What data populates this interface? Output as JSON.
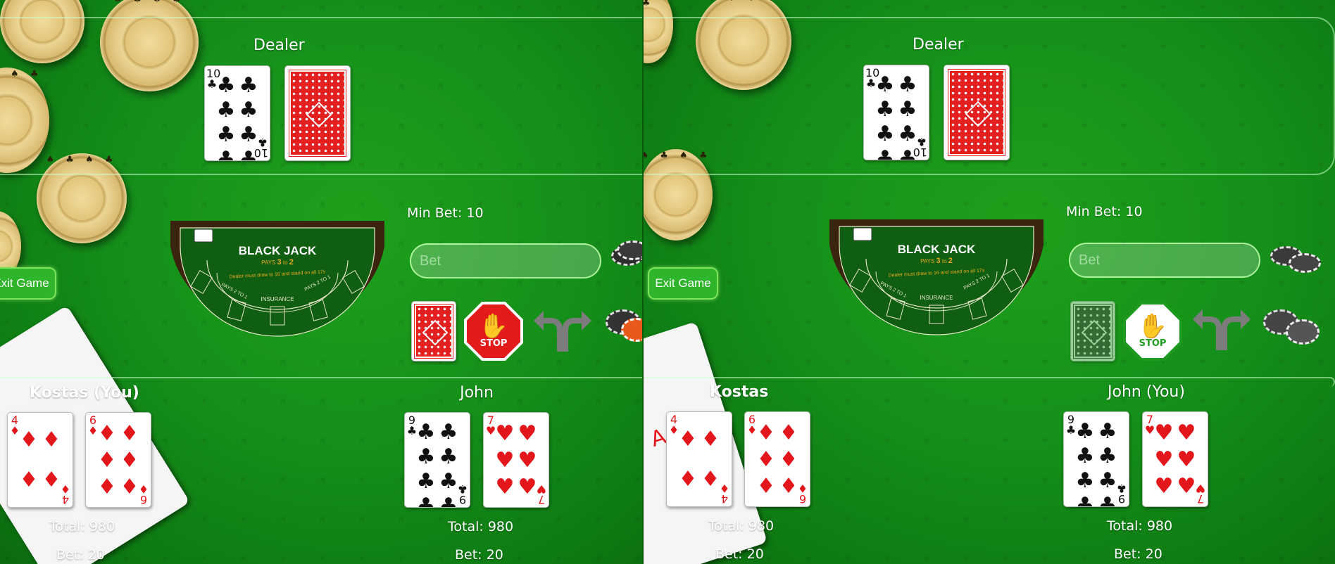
{
  "left": {
    "dealer_label": "Dealer",
    "min_bet": "Min Bet: 10",
    "bet_placeholder": "Bet",
    "exit_label": "Exit Game",
    "player1": {
      "name": "Kostas (You)",
      "total": "Total: 980",
      "bet": "Bet: 20"
    },
    "player2": {
      "name": "John",
      "total": "Total: 980",
      "bet": "Bet: 20"
    },
    "hit_state": "active",
    "stand_state": "active"
  },
  "right": {
    "dealer_label": "Dealer",
    "min_bet": "Min Bet: 10",
    "bet_placeholder": "Bet",
    "exit_label": "Exit Game",
    "player1": {
      "name": "Kostas",
      "total": "Total: 980",
      "bet": "Bet: 20"
    },
    "player2": {
      "name": "John (You)",
      "total": "Total: 980",
      "bet": "Bet: 20"
    },
    "hit_state": "disabled",
    "stand_state": "green"
  },
  "table": {
    "title": "BLACK JACK",
    "pays": "PAYS",
    "pays_3": "3",
    "pays_to": "to",
    "pays_2": "2",
    "rule_text": "Dealer must draw to 16 and stand on all 17s",
    "pays_2_to_1": "PAYS 2 TO 1",
    "insurance": "INSURANCE"
  },
  "cards": {
    "dealer_up": {
      "rank": "10",
      "suit": "♣",
      "color": "black"
    },
    "p1_c1": {
      "rank": "4",
      "suit": "♦",
      "color": "red"
    },
    "p1_c2": {
      "rank": "6",
      "suit": "♦",
      "color": "red"
    },
    "p2_c1": {
      "rank": "9",
      "suit": "♣",
      "color": "black"
    },
    "p2_c2": {
      "rank": "7",
      "suit": "♥",
      "color": "red"
    },
    "bg_ace": {
      "rank": "A",
      "suit": "♠"
    }
  },
  "stop_label": "STOP",
  "colors": {
    "felt": "#15901a",
    "accent_green": "#2fb52b",
    "card_back_red": "#e41f1f",
    "stop_red": "#e31b1b"
  }
}
